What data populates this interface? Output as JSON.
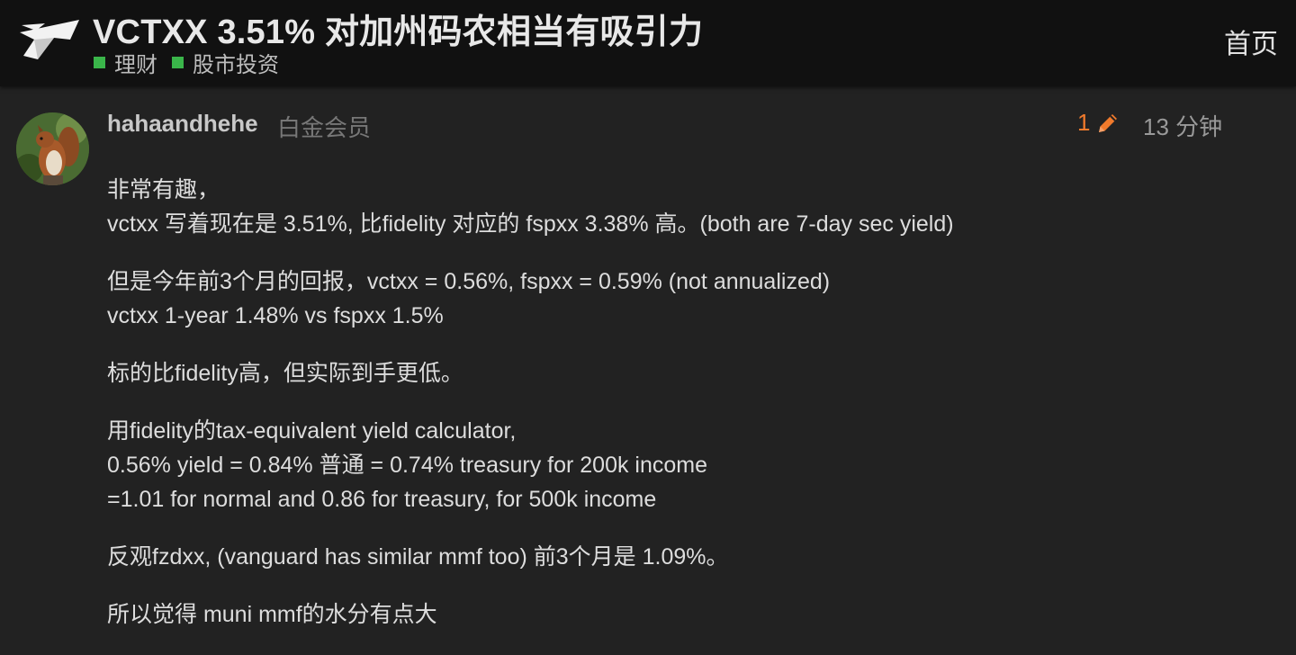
{
  "topic": {
    "title": "VCTXX 3.51% 对加州码农相当有吸引力",
    "categories": [
      {
        "label": "理财",
        "color": "#3ab54a"
      },
      {
        "label": "股市投资",
        "color": "#3ab54a"
      }
    ]
  },
  "header": {
    "home_label": "首页",
    "logo_icon": "paper-plane-logo-icon"
  },
  "post": {
    "username": "hahaandhehe",
    "user_title": "白金会员",
    "edit_count": "1",
    "time": "13 分钟",
    "accent_color": "#f07a2c",
    "paragraphs": [
      [
        "非常有趣，",
        "vctxx 写着现在是 3.51%, 比fidelity 对应的 fspxx 3.38% 高。(both are 7-day sec yield)"
      ],
      [
        "但是今年前3个月的回报，vctxx = 0.56%, fspxx = 0.59% (not annualized)",
        "vctxx 1-year 1.48% vs fspxx 1.5%"
      ],
      [
        "标的比fidelity高，但实际到手更低。"
      ],
      [
        "用fidelity的tax-equivalent yield calculator,",
        "0.56% yield = 0.84% 普通 = 0.74% treasury for 200k income",
        "=1.01 for normal and 0.86 for treasury, for 500k income"
      ],
      [
        "反观fzdxx, (vanguard has similar mmf too) 前3个月是 1.09%。"
      ],
      [
        "所以觉得 muni mmf的水分有点大"
      ]
    ]
  }
}
